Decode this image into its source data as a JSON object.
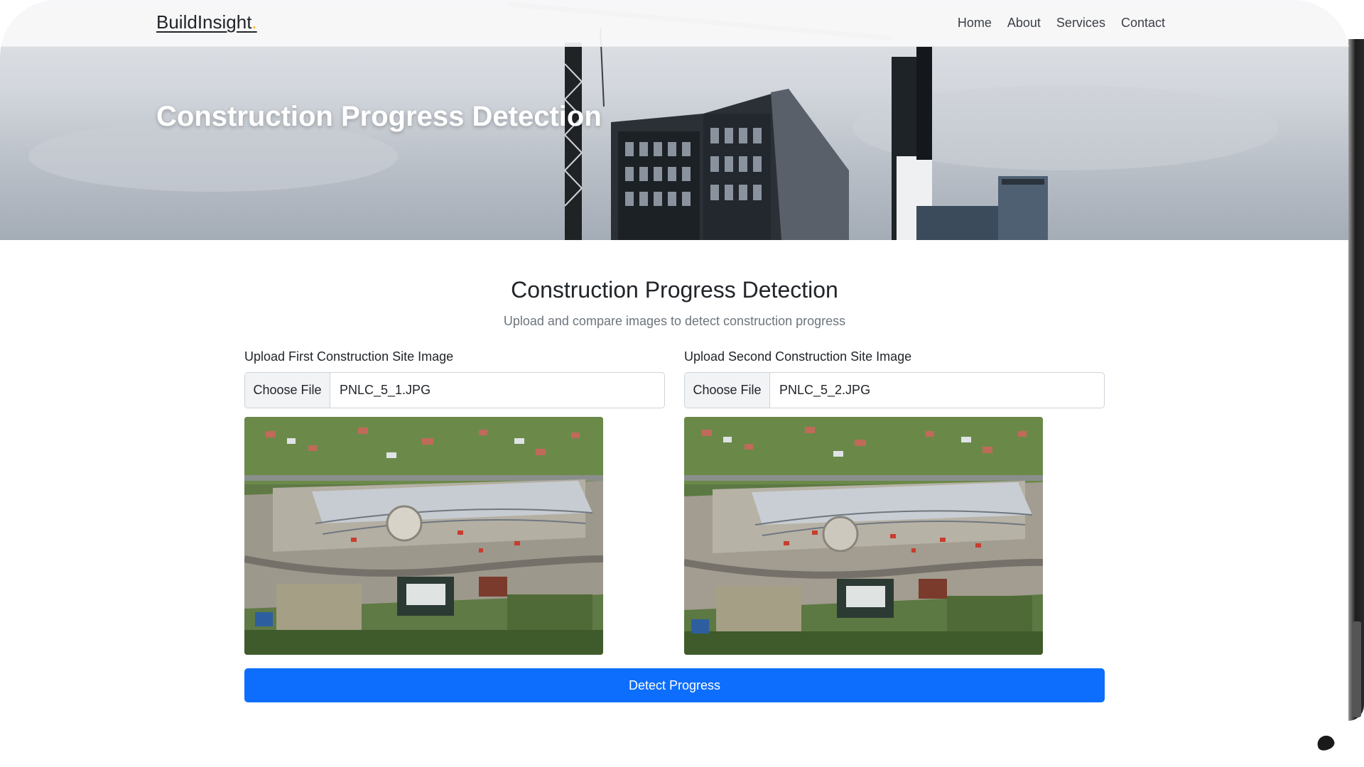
{
  "navbar": {
    "brand": "BuildInsight",
    "brand_dot": ".",
    "links": [
      "Home",
      "About",
      "Services",
      "Contact"
    ]
  },
  "hero": {
    "title": "Construction Progress Detection"
  },
  "main": {
    "title": "Construction Progress Detection",
    "subtitle": "Upload and compare images to detect construction progress",
    "uploads": [
      {
        "label": "Upload First Construction Site Image",
        "button": "Choose File",
        "filename": "PNLC_5_1.JPG"
      },
      {
        "label": "Upload Second Construction Site Image",
        "button": "Choose File",
        "filename": "PNLC_5_2.JPG"
      }
    ],
    "detect_button": "Detect Progress"
  },
  "colors": {
    "primary": "#0d6efd",
    "brand_dot": "#f5b500",
    "navbar_bg": "#f8f9fa"
  }
}
